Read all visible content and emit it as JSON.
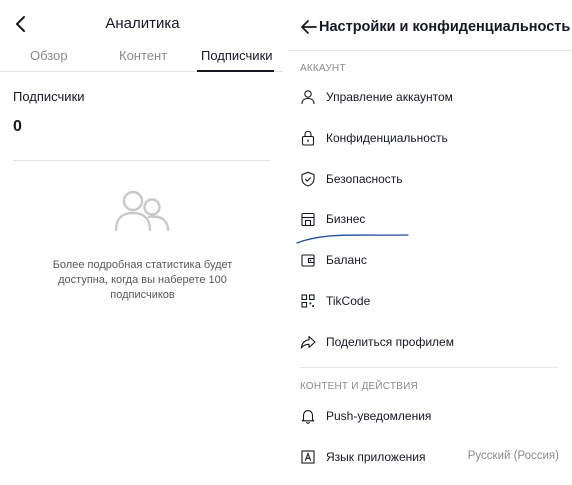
{
  "left": {
    "title": "Аналитика",
    "tabs": [
      {
        "label": "Обзор"
      },
      {
        "label": "Контент"
      },
      {
        "label": "Подписчики"
      }
    ],
    "active_tab": "Подписчики",
    "followers": {
      "label": "Подписчики",
      "value": "0"
    },
    "empty_message": "Более подробная статистика будет доступна, когда вы наберете 100 подписчиков"
  },
  "right": {
    "title": "Настройки и конфиденциальность",
    "sections": [
      {
        "header": "АККАУНТ",
        "items": [
          {
            "label": "Управление аккаунтом",
            "icon": "person-icon"
          },
          {
            "label": "Конфиденциальность",
            "icon": "lock-icon"
          },
          {
            "label": "Безопасность",
            "icon": "shield-icon"
          },
          {
            "label": "Бизнес",
            "icon": "store-icon"
          },
          {
            "label": "Баланс",
            "icon": "wallet-icon"
          },
          {
            "label": "TikCode",
            "icon": "qr-code-icon"
          },
          {
            "label": "Поделиться профилем",
            "icon": "share-icon"
          }
        ]
      },
      {
        "header": "КОНТЕНТ И ДЕЙСТВИЯ",
        "items": [
          {
            "label": "Push-уведомления",
            "icon": "bell-icon"
          },
          {
            "label": "Язык приложения",
            "icon": "language-icon",
            "value": "Русский (Россия)"
          }
        ]
      }
    ]
  },
  "colors": {
    "text": "#161823",
    "muted": "#8a8b91",
    "divider": "#e3e3e4",
    "pen_mark": "#1f4e9a"
  }
}
